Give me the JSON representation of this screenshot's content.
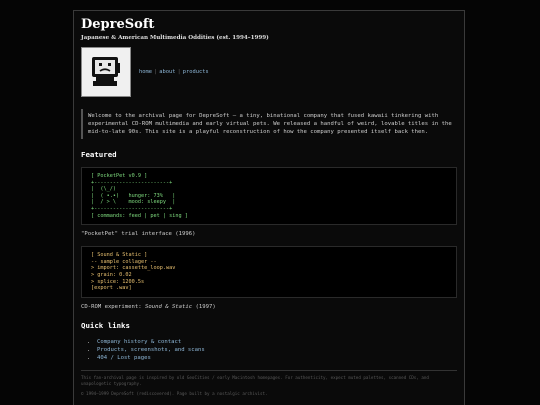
{
  "header": {
    "title": "DepreSoft",
    "tagline": "Japanese & American Multimedia Oddities (est. 1994–1999)"
  },
  "nav": [
    {
      "label": "home"
    },
    {
      "label": "about"
    },
    {
      "label": "products"
    }
  ],
  "intro": "Welcome to the archival page for DepreSoft — a tiny, binational company that fused kawaii tinkering with experimental CD-ROM multimedia and early virtual pets. We released a handful of weird, lovable titles in the mid-to-late 90s. This site is a playful reconstruction of how the company presented itself back then.",
  "featured": {
    "heading": "Featured",
    "pocketpet_ascii": "[ PocketPet v0.9 ]\n+------------------------+\n|  (\\_/)\n|  ( •.•)   hunger: 73%   |\n|  / > \\    mood: sleepy  |\n+------------------------+\n[ commands: feed | pet | sing ]",
    "pocketpet_caption": "\"PocketPet\" trial interface (1996)",
    "sound_ascii": "[ Sound & Static ]\n-- sample collager --\n> import: cassette_loop.wav\n> grain: 0.02\n> splice: 1200.5s\n[export .wav]",
    "sound_caption_prefix": "CD-ROM experiment: ",
    "sound_caption_title": "Sound & Static",
    "sound_caption_year": " (1997)"
  },
  "quick_links": {
    "heading": "Quick links",
    "items": [
      {
        "label": "Company history & contact"
      },
      {
        "label": "Products, screenshots, and scans"
      },
      {
        "label": "404 / Lost pages"
      }
    ]
  },
  "footer": {
    "note": "This fan-archival page is inspired by old GeoCities / early Macintosh homepages. For authenticity, expect muted palettes, scanned CDs, and unapologetic typography.",
    "copyright": "© 1994–1999 DepreSoft (rediscovered). Page built by a nostalgic archivist."
  }
}
